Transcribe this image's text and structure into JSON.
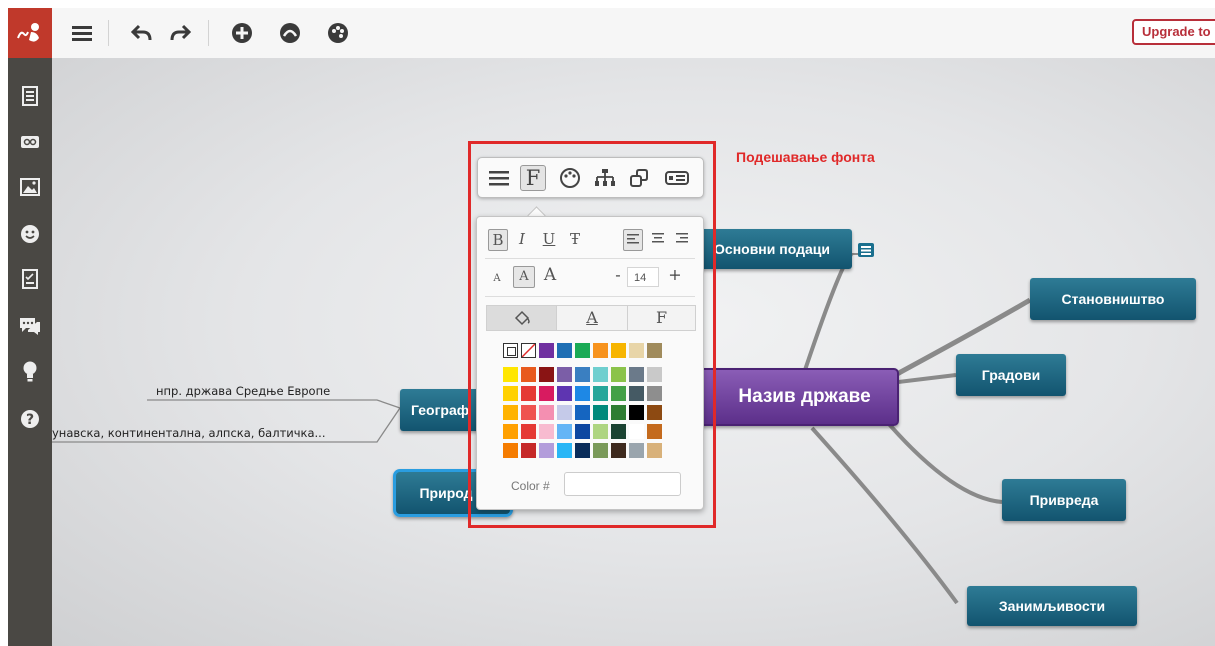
{
  "toolbar": {
    "logo_icon": "mindmeister-logo-icon",
    "menu_icon": "hamburger-menu-icon",
    "undo_icon": "undo-arrow-icon",
    "redo_icon": "redo-arrow-icon",
    "add_icon": "plus-circle-icon",
    "connect_icon": "connect-circle-icon",
    "theme_icon": "palette-circle-icon",
    "upgrade_label": "Upgrade to"
  },
  "sidebar": {
    "items": [
      {
        "icon": "outline-list-icon"
      },
      {
        "icon": "link-icon"
      },
      {
        "icon": "image-icon"
      },
      {
        "icon": "smiley-icon"
      },
      {
        "icon": "task-checklist-icon"
      },
      {
        "icon": "comments-icon"
      },
      {
        "icon": "lightbulb-icon"
      },
      {
        "icon": "help-icon"
      }
    ]
  },
  "map": {
    "central": "Назив државе",
    "nodes": {
      "basic": "Основни подаци",
      "population": "Становништво",
      "cities": "Градови",
      "economy": "Привреда",
      "fun": "Занимљивости",
      "geo": "Географ",
      "nature": "Природ"
    },
    "leaves": {
      "example": "нпр. држава Средње Европе",
      "types": "унавска, континентална, алпска, балтичка..."
    }
  },
  "annotation": {
    "caption": "Подешавање фонта",
    "color": "#e02929"
  },
  "popover": {
    "toolbar_icons": [
      "menu-icon",
      "font-icon",
      "palette-icon",
      "structure-icon",
      "boundary-icon",
      "label-icon"
    ],
    "style_buttons": {
      "bold": "B",
      "italic": "I",
      "underline": "U",
      "strike": "Ŧ"
    },
    "size_buttons": {
      "small": "A",
      "medium": "A",
      "large": "A"
    },
    "font_size": "14",
    "minus": "-",
    "plus": "+",
    "tabs": {
      "fill": "fill-bucket-icon",
      "text": "A",
      "font": "F"
    },
    "color_label": "Color #",
    "color_value": ""
  },
  "colors": {
    "row1": [
      "#7030a0",
      "#1f6fb4",
      "#1aaa55",
      "#f7931e",
      "#f7b500",
      "#e8d5a8",
      "#a08b5c"
    ],
    "grid": [
      [
        "#ffe600",
        "#e85a1e",
        "#8a1414",
        "#7b5ea7",
        "#3a7fc1",
        "#6fcfcf",
        "#8bc34a",
        "#6b7a8a",
        "#c9c9c9"
      ],
      [
        "#ffd100",
        "#e53935",
        "#d81b60",
        "#5e35b1",
        "#1e88e5",
        "#26a69a",
        "#43a047",
        "#455a64",
        "#8e8e8e"
      ],
      [
        "#ffb300",
        "#ef5350",
        "#f48fb1",
        "#c5cae9",
        "#1565c0",
        "#00897b",
        "#2e7d32",
        "#000000",
        "#8d4a12"
      ],
      [
        "#ffa000",
        "#e53935",
        "#f8bbd0",
        "#64b5f6",
        "#0d47a1",
        "#aed581",
        "#1b4332",
        "#ffffff",
        "#c46a1d"
      ],
      [
        "#f57c00",
        "#c62828",
        "#b39ddb",
        "#29b6f6",
        "#0a2d5a",
        "#7a9a5a",
        "#3e2a1e",
        "#9aa5ad",
        "#d8b17a"
      ]
    ]
  }
}
